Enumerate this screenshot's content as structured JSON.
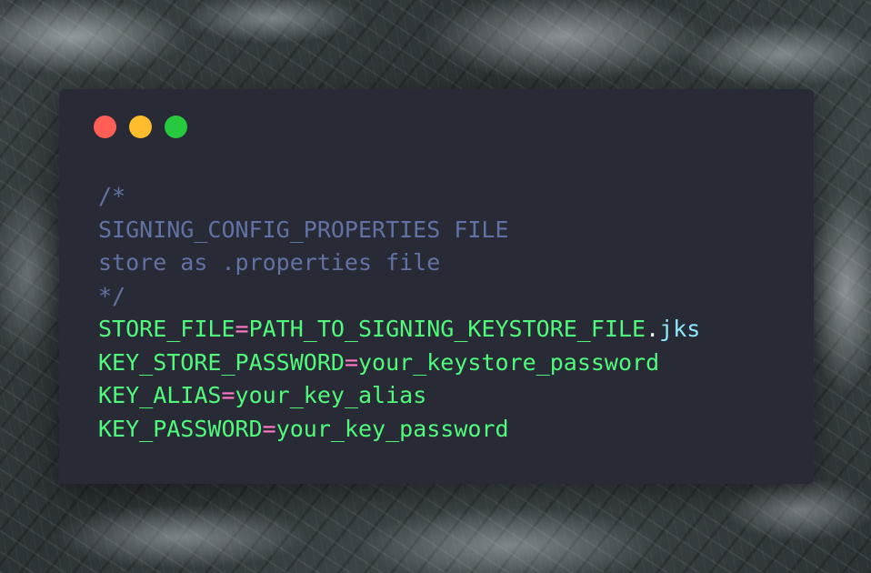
{
  "colors": {
    "window_bg": "#282a36",
    "close": "#ff5f56",
    "minimize": "#ffbd2e",
    "maximize": "#27c93f",
    "comment": "#6272a4",
    "key": "#50fa7b",
    "operator": "#ff79c6",
    "punctuation": "#f8f8f2",
    "extension": "#8be9fd"
  },
  "code": {
    "comments": [
      "/*",
      "SIGNING_CONFIG_PROPERTIES FILE",
      "store as .properties file",
      "*/"
    ],
    "assignments": [
      {
        "key": "STORE_FILE",
        "op": "=",
        "value": "PATH_TO_SIGNING_KEYSTORE_FILE",
        "dot": ".",
        "ext": "jks"
      },
      {
        "key": "KEY_STORE_PASSWORD",
        "op": "=",
        "value": "your_keystore_password"
      },
      {
        "key": "KEY_ALIAS",
        "op": "=",
        "value": "your_key_alias"
      },
      {
        "key": "KEY_PASSWORD",
        "op": "=",
        "value": "your_key_password"
      }
    ]
  }
}
